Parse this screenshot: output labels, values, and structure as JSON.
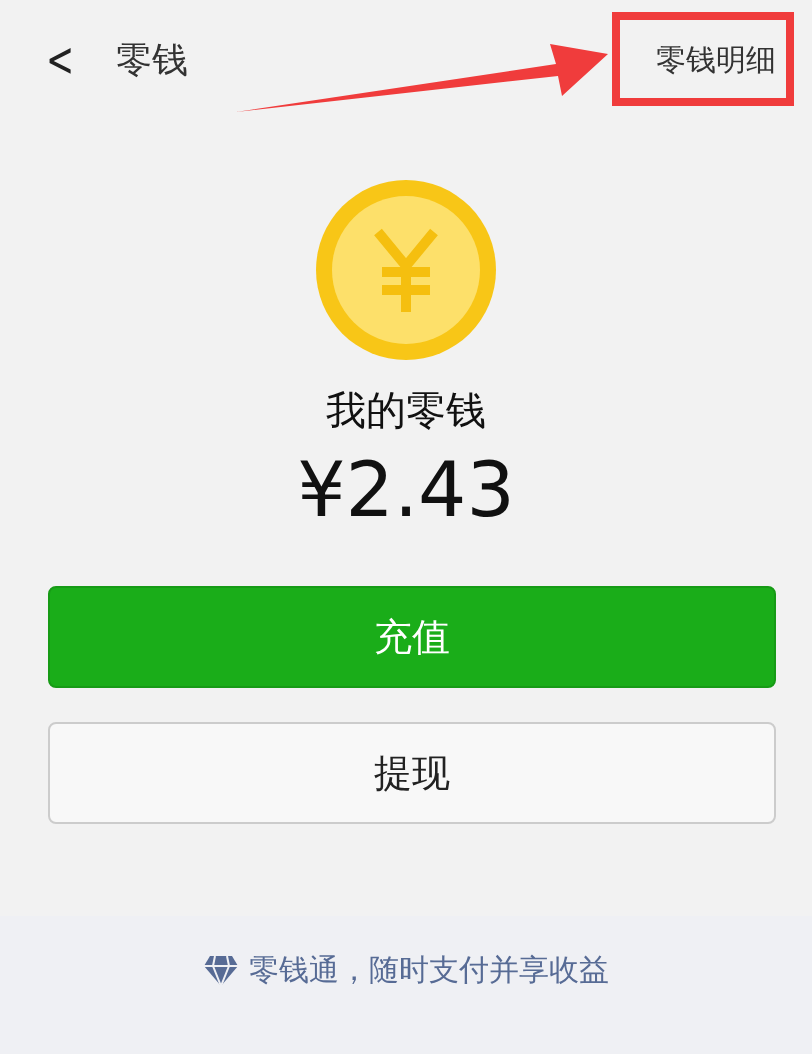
{
  "header": {
    "back_icon": "<",
    "title": "零钱",
    "action": "零钱明细"
  },
  "balance": {
    "label": "我的零钱",
    "amount": "¥2.43"
  },
  "buttons": [
    {
      "label": "充值",
      "kind": "primary"
    },
    {
      "label": "提现",
      "kind": "secondary"
    }
  ],
  "footer": {
    "text": "零钱通，随时支付并享收益"
  }
}
